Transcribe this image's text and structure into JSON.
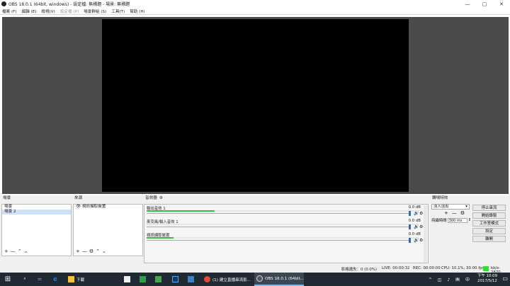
{
  "window": {
    "title": "OBS 18.0.1 (64bit, windows) - 設定檔: 無標題 - 場景: 無標題",
    "controls": [
      "—",
      "▢",
      "✕"
    ]
  },
  "menu": [
    {
      "label": "檔案 (F)",
      "enabled": true
    },
    {
      "label": "編輯 (E)",
      "enabled": true
    },
    {
      "label": "檢視(V)",
      "enabled": true
    },
    {
      "label": "設定檔 (P)",
      "enabled": false
    },
    {
      "label": "場景群組 (S)",
      "enabled": true
    },
    {
      "label": "工具(T)",
      "enabled": true
    },
    {
      "label": "幫助 (H)",
      "enabled": true
    }
  ],
  "scenes": {
    "title": "場景",
    "items": [
      {
        "label": "場景",
        "selected": false
      },
      {
        "label": "場景 2",
        "selected": true
      }
    ],
    "tools": [
      "+",
      "—",
      "⌃",
      "⌄"
    ]
  },
  "sources": {
    "title": "來源",
    "items": [
      {
        "label": "視訊擷取裝置",
        "icon": "eye-icon"
      }
    ],
    "tools": [
      "+",
      "—",
      "⚙",
      "⌃",
      "⌄"
    ]
  },
  "mixer": {
    "title": "音效器",
    "channels": [
      {
        "name": "輸出音效 1",
        "db": "0.0 dB",
        "level": 0.25
      },
      {
        "name": "麥克風/輸入音效 1",
        "db": "0.0 dB",
        "level": 0.0
      },
      {
        "name": "視訊擷取裝置",
        "db": "0.0 dB",
        "level": 0.1
      }
    ]
  },
  "transitions": {
    "title": "轉場特效",
    "selected": "淡入淡出",
    "duration_label": "持續時間",
    "duration_value": "300 ms"
  },
  "controls": {
    "buttons": [
      "停止串流",
      "開始錄製",
      "工作室模式",
      "設定",
      "離開"
    ]
  },
  "status": {
    "dropped": "影格遺失：0 (0.0%)",
    "live": "LIVE: 00:00:32",
    "rec": "REC: 00:00:00",
    "cpu": "CPU: 10.1%, 30.00 fps",
    "bitrate": "kb/s: 2870",
    "indicator_color": "#33dd33"
  },
  "taskbar": {
    "apps": [
      {
        "label": "下載",
        "icon": "folder-icon",
        "color": "#f0c040"
      },
      {
        "label": "(1) 建立直播串流影...",
        "icon": "chrome-icon",
        "color": "#e24a3b"
      },
      {
        "label": "OBS 18.0.1 (64bit...",
        "icon": "obs-icon",
        "color": "#555555",
        "active": true
      }
    ],
    "time": "下午 10:09",
    "date": "2017/5/12"
  }
}
